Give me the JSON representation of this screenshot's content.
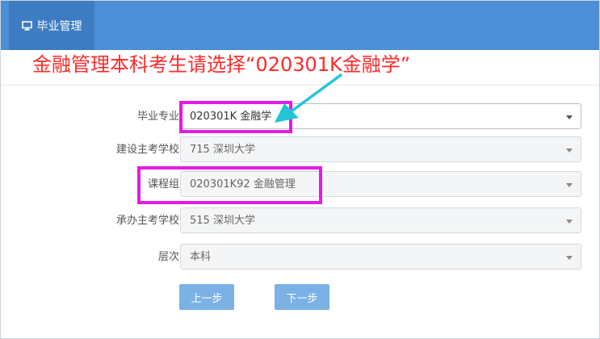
{
  "header": {
    "tab_label": "毕业管理",
    "tab_icon": "monitor-icon",
    "bar_color": "#4d8fd6",
    "active_tab_color": "#3d7cc2"
  },
  "annotation": {
    "text": "金融管理本科考生请选择“020301K金融学”",
    "color": "#ff2a2a",
    "highlight_color": "#e619e6",
    "arrow_color": "#22c5d8"
  },
  "form": {
    "major": {
      "label": "毕业专业",
      "value": "020301K 金融学"
    },
    "main_school": {
      "label": "建设主考学校",
      "value": "715 深圳大学"
    },
    "course_group": {
      "label": "课程组",
      "value": "020301K92 金融管理"
    },
    "host_school": {
      "label": "承办主考学校",
      "value": "515 深圳大学"
    },
    "level": {
      "label": "层次",
      "value": "本科"
    }
  },
  "buttons": {
    "prev_label": "上一步",
    "next_label": "下一步",
    "color": "#7cb1e6"
  }
}
